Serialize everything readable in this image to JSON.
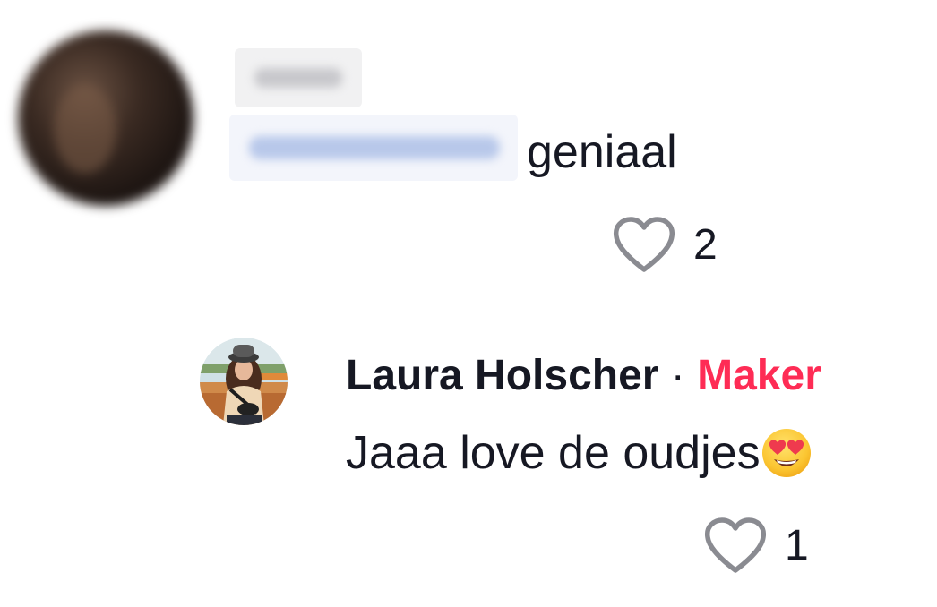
{
  "comment": {
    "text": "geniaal",
    "like_count": "2",
    "icons": {
      "like": "heart-outline-icon"
    }
  },
  "reply": {
    "author": "Laura Holscher",
    "separator": "·",
    "badge": "Maker",
    "text": "Jaaa love de oudjes",
    "emoji": "😍",
    "like_count": "1",
    "icons": {
      "like": "heart-outline-icon",
      "emoji": "smiling-face-with-heart-eyes-emoji"
    }
  },
  "colors": {
    "text": "#161823",
    "badge": "#fe2c55",
    "icon": "#8a8b91"
  }
}
